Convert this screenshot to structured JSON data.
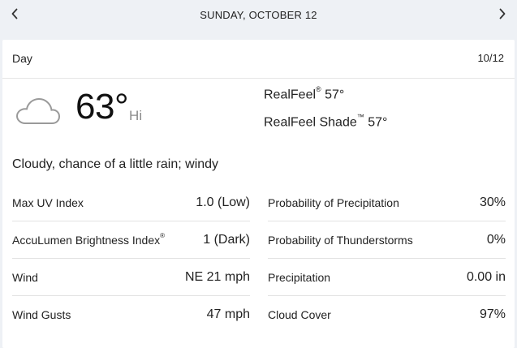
{
  "nav": {
    "date": "SUNDAY, OCTOBER 12",
    "prev_icon": "chevron-left-icon",
    "next_icon": "chevron-right-icon"
  },
  "card": {
    "title": "Day",
    "date": "10/12",
    "weather_icon": "cloud-icon",
    "temperature": "63°",
    "temp_label": "Hi",
    "realfeel_label": "RealFeel",
    "realfeel_value": "57°",
    "realfeel_shade_label": "RealFeel Shade",
    "realfeel_shade_value": "57°",
    "trademark": "®",
    "trademark_tm": "™",
    "phrase": "Cloudy, chance of a little rain; windy"
  },
  "details_left": [
    {
      "label": "Max UV Index",
      "value": "1.0 (Low)"
    },
    {
      "label": "AccuLumen Brightness Index",
      "value": "1 (Dark)"
    },
    {
      "label": "Wind",
      "value": "NE 21 mph"
    },
    {
      "label": "Wind Gusts",
      "value": "47 mph"
    }
  ],
  "details_right": [
    {
      "label": "Probability of Precipitation",
      "value": "30%"
    },
    {
      "label": "Probability of Thunderstorms",
      "value": "0%"
    },
    {
      "label": "Precipitation",
      "value": "0.00 in"
    },
    {
      "label": "Cloud Cover",
      "value": "97%"
    }
  ],
  "colors": {
    "background": "#eef1f5",
    "card": "#ffffff",
    "text": "#222222",
    "muted": "#8b8b8b"
  }
}
